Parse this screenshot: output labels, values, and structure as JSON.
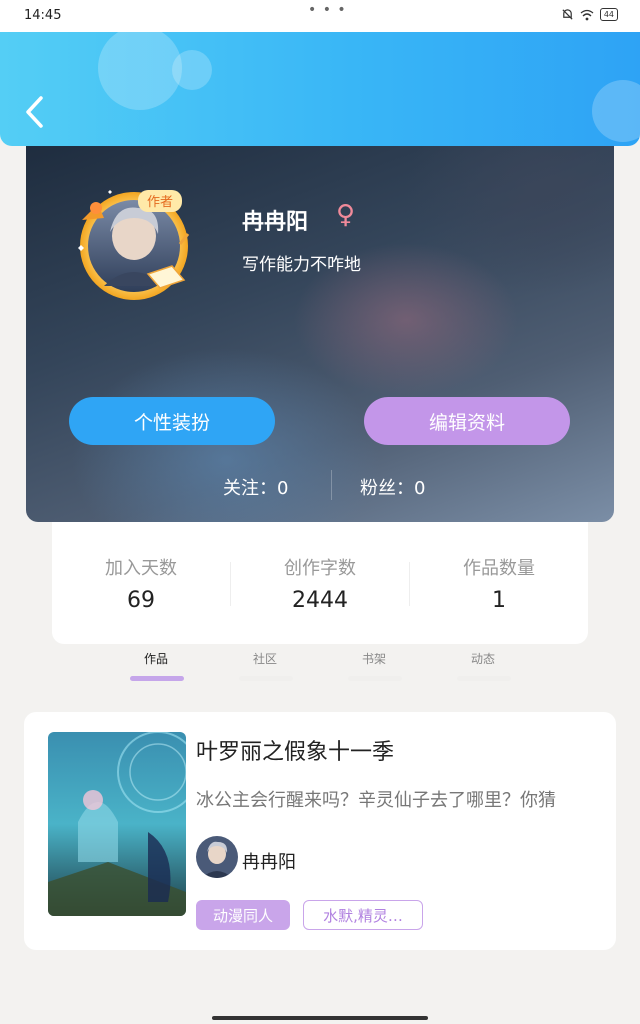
{
  "status_bar": {
    "time": "14:45",
    "dots": "• • •",
    "battery": "44"
  },
  "profile": {
    "name": "冉冉阳",
    "gender_symbol": "♀",
    "bio": "写作能力不咋地",
    "badge": "作者",
    "btn_dress": "个性装扮",
    "btn_edit": "编辑资料",
    "following_label": "关注：0",
    "followers_label": "粉丝：0"
  },
  "stats": [
    {
      "label": "加入天数",
      "value": "69"
    },
    {
      "label": "创作字数",
      "value": "2444"
    },
    {
      "label": "作品数量",
      "value": "1"
    }
  ],
  "tabs": [
    {
      "label": "作品",
      "active": true
    },
    {
      "label": "社区",
      "active": false
    },
    {
      "label": "书架",
      "active": false
    },
    {
      "label": "动态",
      "active": false
    }
  ],
  "works": [
    {
      "title": "叶罗丽之假象十一季",
      "description": "冰公主会行醒来吗？辛灵仙子去了哪里？你猜",
      "author": "冉冉阳",
      "tags": [
        "动漫同人",
        "水默,精灵…"
      ]
    }
  ],
  "colors": {
    "header_start": "#54cef5",
    "header_end": "#2ea3f5",
    "accent_purple": "#c396e9",
    "accent_blue": "#2fa5f5"
  }
}
